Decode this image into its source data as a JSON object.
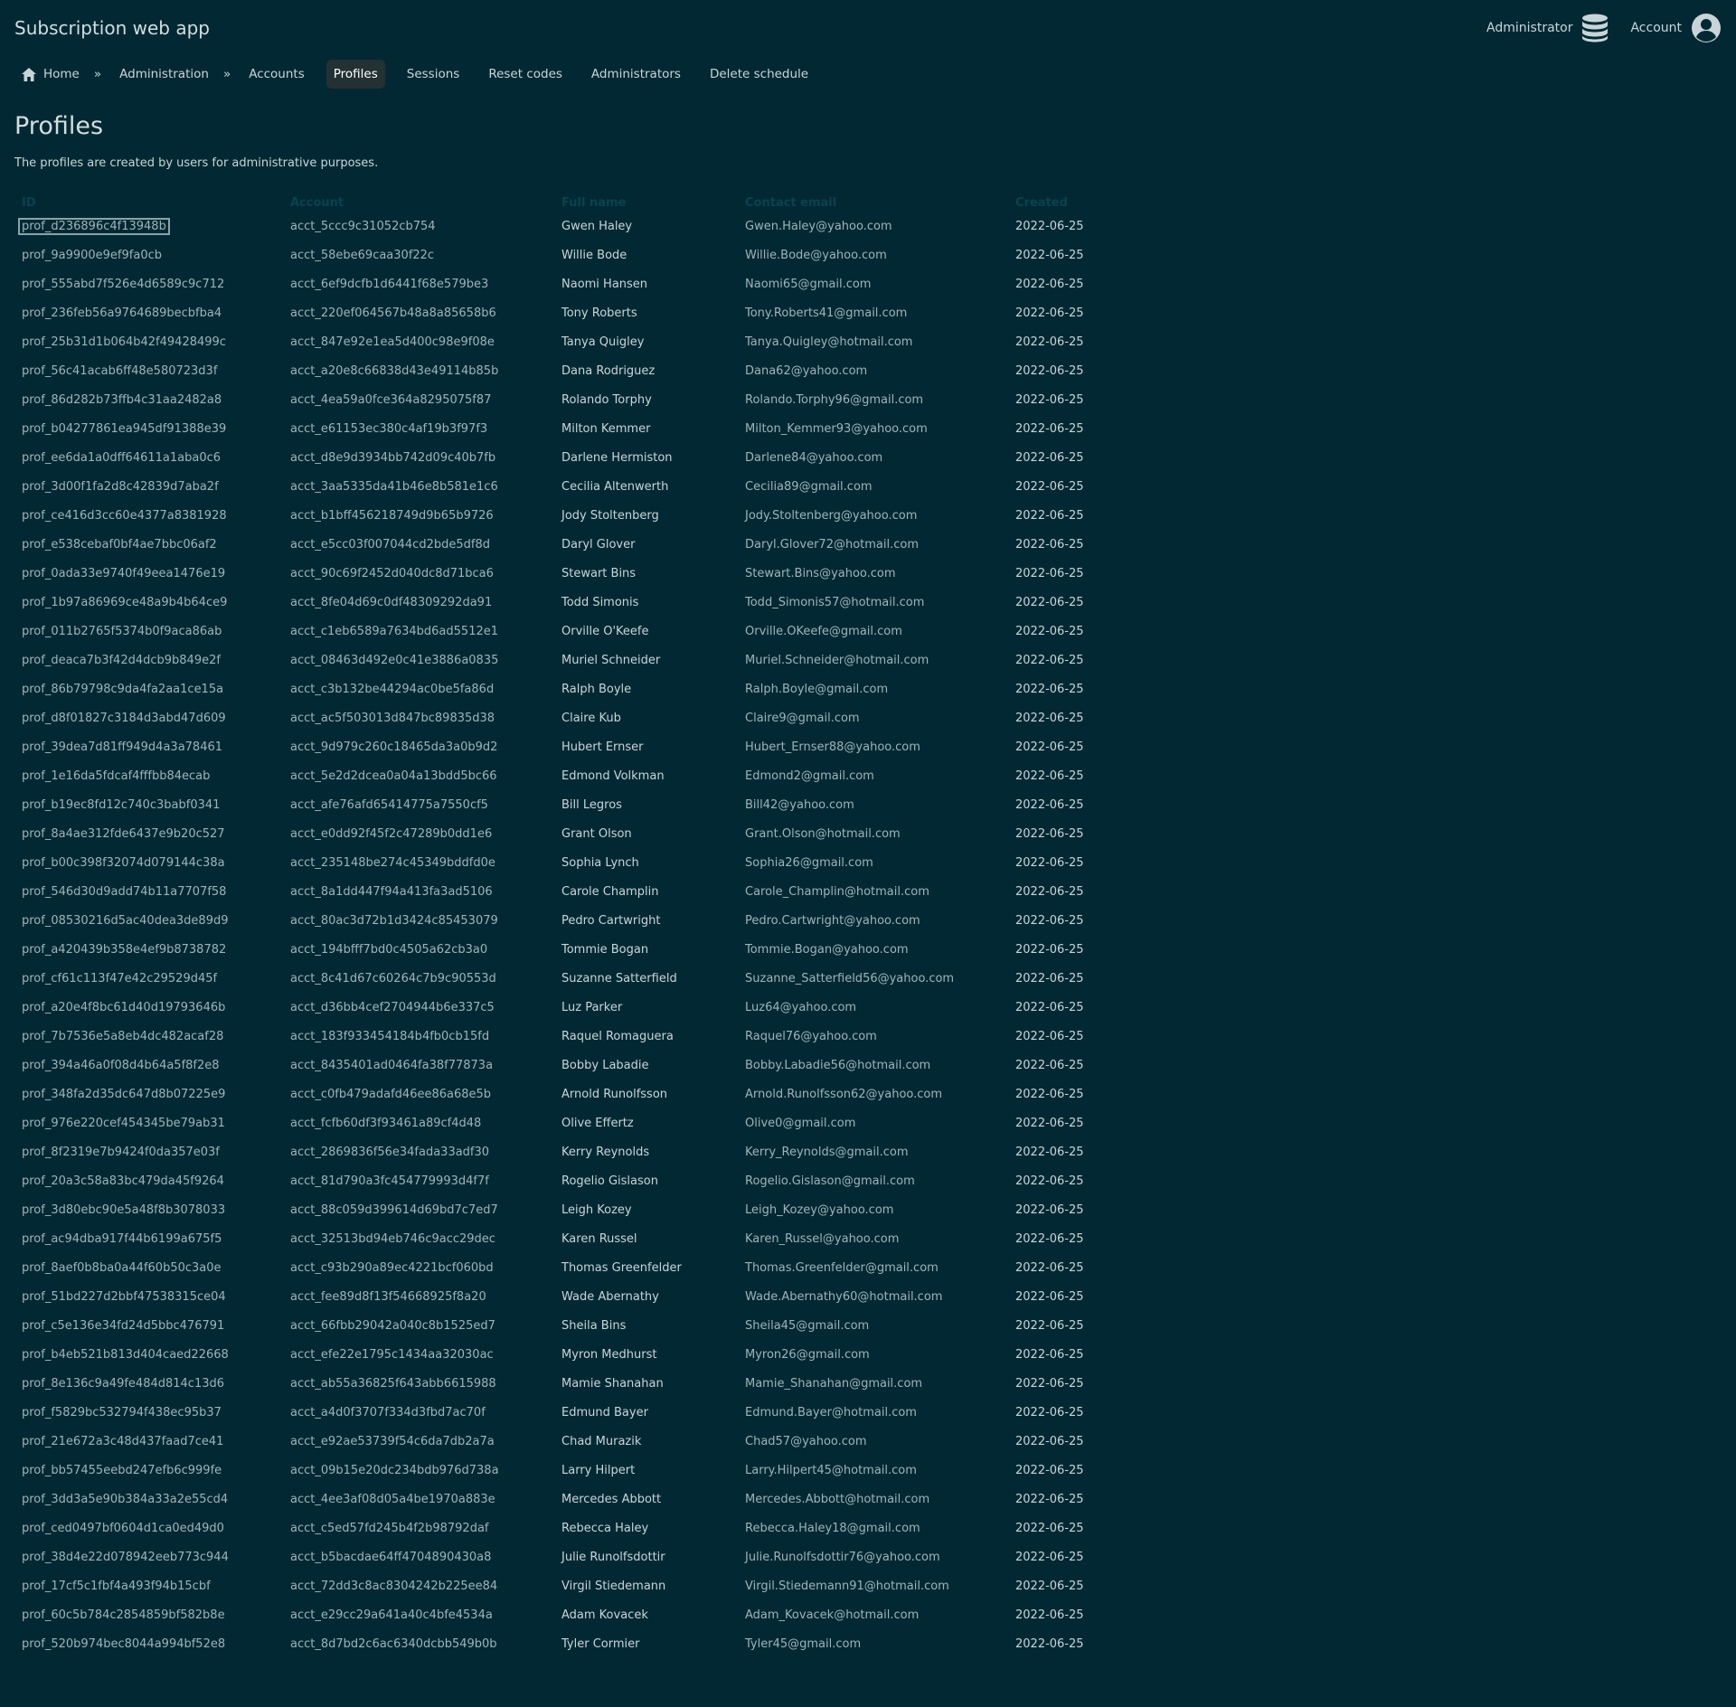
{
  "app_title": "Subscription web app",
  "top_right": {
    "admin_label": "Administrator",
    "admin_icon": "database-icon",
    "account_label": "Account",
    "account_icon": "user-circle-icon"
  },
  "nav": {
    "home": "Home",
    "separator": "»",
    "administration": "Administration",
    "accounts": "Accounts",
    "profiles": "Profiles",
    "sessions": "Sessions",
    "reset_codes": "Reset codes",
    "administrators": "Administrators",
    "delete_schedule": "Delete schedule"
  },
  "page_title": "Profiles",
  "description": "The profiles are created by users for administrative purposes.",
  "table": {
    "headers": [
      "ID",
      "Account",
      "Full name",
      "Contact email",
      "Created"
    ],
    "rows": [
      [
        "prof_d236896c4f13948b",
        "acct_5ccc9c31052cb754",
        "Gwen Haley",
        "Gwen.Haley@yahoo.com",
        "2022-06-25"
      ],
      [
        "prof_9a9900e9ef9fa0cb",
        "acct_58ebe69caa30f22c",
        "Willie Bode",
        "Willie.Bode@yahoo.com",
        "2022-06-25"
      ],
      [
        "prof_555abd7f526e4d6589c9c712",
        "acct_6ef9dcfb1d6441f68e579be3",
        "Naomi Hansen",
        "Naomi65@gmail.com",
        "2022-06-25"
      ],
      [
        "prof_236feb56a9764689becbfba4",
        "acct_220ef064567b48a8a85658b6",
        "Tony Roberts",
        "Tony.Roberts41@gmail.com",
        "2022-06-25"
      ],
      [
        "prof_25b31d1b064b42f49428499c",
        "acct_847e92e1ea5d400c98e9f08e",
        "Tanya Quigley",
        "Tanya.Quigley@hotmail.com",
        "2022-06-25"
      ],
      [
        "prof_56c41acab6ff48e580723d3f",
        "acct_a20e8c66838d43e49114b85b",
        "Dana Rodriguez",
        "Dana62@yahoo.com",
        "2022-06-25"
      ],
      [
        "prof_86d282b73ffb4c31aa2482a8",
        "acct_4ea59a0fce364a8295075f87",
        "Rolando Torphy",
        "Rolando.Torphy96@gmail.com",
        "2022-06-25"
      ],
      [
        "prof_b04277861ea945df91388e39",
        "acct_e61153ec380c4af19b3f97f3",
        "Milton Kemmer",
        "Milton_Kemmer93@yahoo.com",
        "2022-06-25"
      ],
      [
        "prof_ee6da1a0dff64611a1aba0c6",
        "acct_d8e9d3934bb742d09c40b7fb",
        "Darlene Hermiston",
        "Darlene84@yahoo.com",
        "2022-06-25"
      ],
      [
        "prof_3d00f1fa2d8c42839d7aba2f",
        "acct_3aa5335da41b46e8b581e1c6",
        "Cecilia Altenwerth",
        "Cecilia89@gmail.com",
        "2022-06-25"
      ],
      [
        "prof_ce416d3cc60e4377a8381928",
        "acct_b1bff456218749d9b65b9726",
        "Jody Stoltenberg",
        "Jody.Stoltenberg@yahoo.com",
        "2022-06-25"
      ],
      [
        "prof_e538cebaf0bf4ae7bbc06af2",
        "acct_e5cc03f007044cd2bde5df8d",
        "Daryl Glover",
        "Daryl.Glover72@hotmail.com",
        "2022-06-25"
      ],
      [
        "prof_0ada33e9740f49eea1476e19",
        "acct_90c69f2452d040dc8d71bca6",
        "Stewart Bins",
        "Stewart.Bins@yahoo.com",
        "2022-06-25"
      ],
      [
        "prof_1b97a86969ce48a9b4b64ce9",
        "acct_8fe04d69c0df48309292da91",
        "Todd Simonis",
        "Todd_Simonis57@hotmail.com",
        "2022-06-25"
      ],
      [
        "prof_011b2765f5374b0f9aca86ab",
        "acct_c1eb6589a7634bd6ad5512e1",
        "Orville O'Keefe",
        "Orville.OKeefe@gmail.com",
        "2022-06-25"
      ],
      [
        "prof_deaca7b3f42d4dcb9b849e2f",
        "acct_08463d492e0c41e3886a0835",
        "Muriel Schneider",
        "Muriel.Schneider@hotmail.com",
        "2022-06-25"
      ],
      [
        "prof_86b79798c9da4fa2aa1ce15a",
        "acct_c3b132be44294ac0be5fa86d",
        "Ralph Boyle",
        "Ralph.Boyle@gmail.com",
        "2022-06-25"
      ],
      [
        "prof_d8f01827c3184d3abd47d609",
        "acct_ac5f503013d847bc89835d38",
        "Claire Kub",
        "Claire9@gmail.com",
        "2022-06-25"
      ],
      [
        "prof_39dea7d81ff949d4a3a78461",
        "acct_9d979c260c18465da3a0b9d2",
        "Hubert Ernser",
        "Hubert_Ernser88@yahoo.com",
        "2022-06-25"
      ],
      [
        "prof_1e16da5fdcaf4fffbb84ecab",
        "acct_5e2d2dcea0a04a13bdd5bc66",
        "Edmond Volkman",
        "Edmond2@gmail.com",
        "2022-06-25"
      ],
      [
        "prof_b19ec8fd12c740c3babf0341",
        "acct_afe76afd65414775a7550cf5",
        "Bill Legros",
        "Bill42@yahoo.com",
        "2022-06-25"
      ],
      [
        "prof_8a4ae312fde6437e9b20c527",
        "acct_e0dd92f45f2c47289b0dd1e6",
        "Grant Olson",
        "Grant.Olson@hotmail.com",
        "2022-06-25"
      ],
      [
        "prof_b00c398f32074d079144c38a",
        "acct_235148be274c45349bddfd0e",
        "Sophia Lynch",
        "Sophia26@gmail.com",
        "2022-06-25"
      ],
      [
        "prof_546d30d9add74b11a7707f58",
        "acct_8a1dd447f94a413fa3ad5106",
        "Carole Champlin",
        "Carole_Champlin@hotmail.com",
        "2022-06-25"
      ],
      [
        "prof_08530216d5ac40dea3de89d9",
        "acct_80ac3d72b1d3424c85453079",
        "Pedro Cartwright",
        "Pedro.Cartwright@yahoo.com",
        "2022-06-25"
      ],
      [
        "prof_a420439b358e4ef9b8738782",
        "acct_194bfff7bd0c4505a62cb3a0",
        "Tommie Bogan",
        "Tommie.Bogan@yahoo.com",
        "2022-06-25"
      ],
      [
        "prof_cf61c113f47e42c29529d45f",
        "acct_8c41d67c60264c7b9c90553d",
        "Suzanne Satterfield",
        "Suzanne_Satterfield56@yahoo.com",
        "2022-06-25"
      ],
      [
        "prof_a20e4f8bc61d40d19793646b",
        "acct_d36bb4cef2704944b6e337c5",
        "Luz Parker",
        "Luz64@yahoo.com",
        "2022-06-25"
      ],
      [
        "prof_7b7536e5a8eb4dc482acaf28",
        "acct_183f933454184b4fb0cb15fd",
        "Raquel Romaguera",
        "Raquel76@yahoo.com",
        "2022-06-25"
      ],
      [
        "prof_394a46a0f08d4b64a5f8f2e8",
        "acct_8435401ad0464fa38f77873a",
        "Bobby Labadie",
        "Bobby.Labadie56@hotmail.com",
        "2022-06-25"
      ],
      [
        "prof_348fa2d35dc647d8b07225e9",
        "acct_c0fb479adafd46ee86a68e5b",
        "Arnold Runolfsson",
        "Arnold.Runolfsson62@yahoo.com",
        "2022-06-25"
      ],
      [
        "prof_976e220cef454345be79ab31",
        "acct_fcfb60df3f93461a89cf4d48",
        "Olive Effertz",
        "Olive0@gmail.com",
        "2022-06-25"
      ],
      [
        "prof_8f2319e7b9424f0da357e03f",
        "acct_2869836f56e34fada33adf30",
        "Kerry Reynolds",
        "Kerry_Reynolds@gmail.com",
        "2022-06-25"
      ],
      [
        "prof_20a3c58a83bc479da45f9264",
        "acct_81d790a3fc454779993d4f7f",
        "Rogelio Gislason",
        "Rogelio.Gislason@gmail.com",
        "2022-06-25"
      ],
      [
        "prof_3d80ebc90e5a48f8b3078033",
        "acct_88c059d399614d69bd7c7ed7",
        "Leigh Kozey",
        "Leigh_Kozey@yahoo.com",
        "2022-06-25"
      ],
      [
        "prof_ac94dba917f44b6199a675f5",
        "acct_32513bd94eb746c9acc29dec",
        "Karen Russel",
        "Karen_Russel@yahoo.com",
        "2022-06-25"
      ],
      [
        "prof_8aef0b8ba0a44f60b50c3a0e",
        "acct_c93b290a89ec4221bcf060bd",
        "Thomas Greenfelder",
        "Thomas.Greenfelder@gmail.com",
        "2022-06-25"
      ],
      [
        "prof_51bd227d2bbf47538315ce04",
        "acct_fee89d8f13f54668925f8a20",
        "Wade Abernathy",
        "Wade.Abernathy60@hotmail.com",
        "2022-06-25"
      ],
      [
        "prof_c5e136e34fd24d5bbc476791",
        "acct_66fbb29042a040c8b1525ed7",
        "Sheila Bins",
        "Sheila45@gmail.com",
        "2022-06-25"
      ],
      [
        "prof_b4eb521b813d404caed22668",
        "acct_efe22e1795c1434aa32030ac",
        "Myron Medhurst",
        "Myron26@gmail.com",
        "2022-06-25"
      ],
      [
        "prof_8e136c9a49fe484d814c13d6",
        "acct_ab55a36825f643abb6615988",
        "Mamie Shanahan",
        "Mamie_Shanahan@gmail.com",
        "2022-06-25"
      ],
      [
        "prof_f5829bc532794f438ec95b37",
        "acct_a4d0f3707f334d3fbd7ac70f",
        "Edmund Bayer",
        "Edmund.Bayer@hotmail.com",
        "2022-06-25"
      ],
      [
        "prof_21e672a3c48d437faad7ce41",
        "acct_e92ae53739f54c6da7db2a7a",
        "Chad Murazik",
        "Chad57@yahoo.com",
        "2022-06-25"
      ],
      [
        "prof_bb57455eebd247efb6c999fe",
        "acct_09b15e20dc234bdb976d738a",
        "Larry Hilpert",
        "Larry.Hilpert45@hotmail.com",
        "2022-06-25"
      ],
      [
        "prof_3dd3a5e90b384a33a2e55cd4",
        "acct_4ee3af08d05a4be1970a883e",
        "Mercedes Abbott",
        "Mercedes.Abbott@hotmail.com",
        "2022-06-25"
      ],
      [
        "prof_ced0497bf0604d1ca0ed49d0",
        "acct_c5ed57fd245b4f2b98792daf",
        "Rebecca Haley",
        "Rebecca.Haley18@gmail.com",
        "2022-06-25"
      ],
      [
        "prof_38d4e22d078942eeb773c944",
        "acct_b5bacdae64ff4704890430a8",
        "Julie Runolfsdottir",
        "Julie.Runolfsdottir76@yahoo.com",
        "2022-06-25"
      ],
      [
        "prof_17cf5c1fbf4a493f94b15cbf",
        "acct_72dd3c8ac8304242b225ee84",
        "Virgil Stiedemann",
        "Virgil.Stiedemann91@hotmail.com",
        "2022-06-25"
      ],
      [
        "prof_60c5b784c2854859bf582b8e",
        "acct_e29cc29a641a40c4bfe4534a",
        "Adam Kovacek",
        "Adam_Kovacek@hotmail.com",
        "2022-06-25"
      ],
      [
        "prof_520b974bec8044a994bf52e8",
        "acct_8d7bd2c6ac6340dcbb549b0b",
        "Tyler Cormier",
        "Tyler45@gmail.com",
        "2022-06-25"
      ]
    ]
  }
}
